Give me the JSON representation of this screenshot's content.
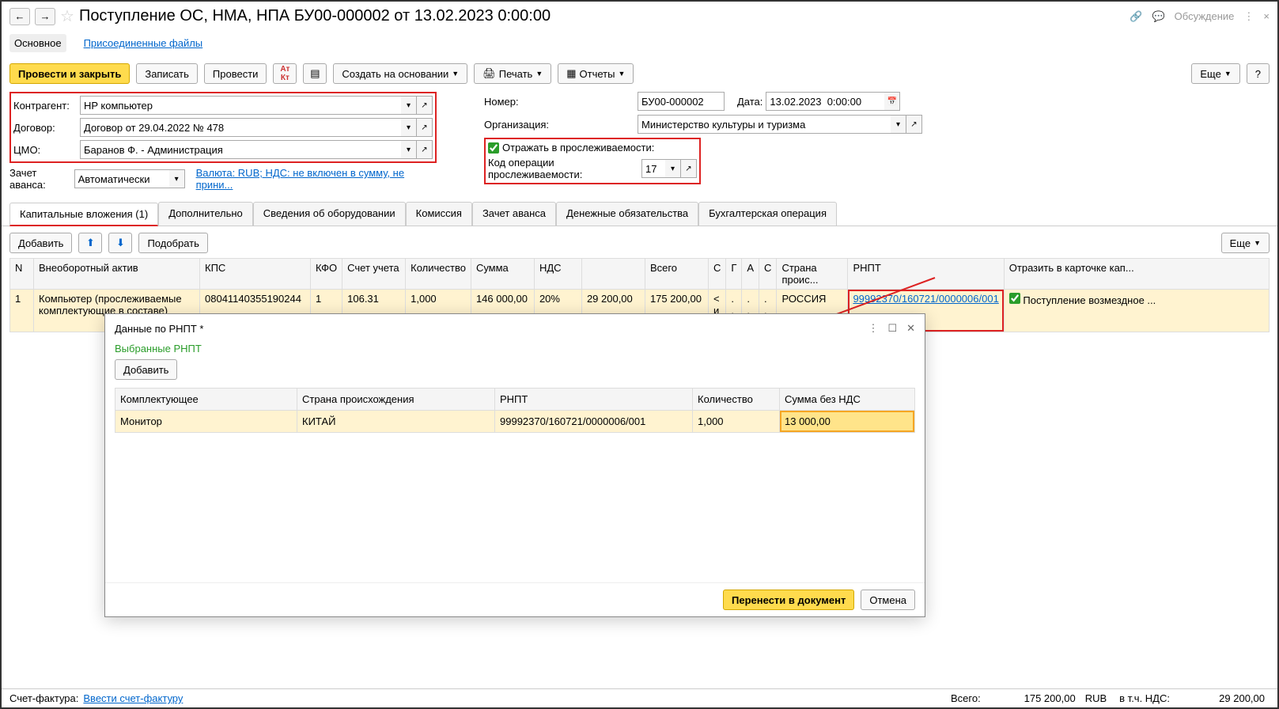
{
  "title": "Поступление ОС, НМА, НПА БУ00-000002 от 13.02.2023 0:00:00",
  "discussion": "Обсуждение",
  "subnav": {
    "main": "Основное",
    "files": "Присоединенные файлы"
  },
  "toolbar": {
    "post_close": "Провести и закрыть",
    "save": "Записать",
    "post": "Провести",
    "create_based": "Создать на основании",
    "print": "Печать",
    "reports": "Отчеты",
    "more": "Еще",
    "help": "?"
  },
  "form": {
    "contragent_lbl": "Контрагент:",
    "contragent": "HP компьютер",
    "contract_lbl": "Договор:",
    "contract": "Договор от 29.04.2022 № 478",
    "cmo_lbl": "ЦМО:",
    "cmo": "Баранов Ф. - Администрация",
    "advance_lbl": "Зачет аванса:",
    "advance": "Автоматически",
    "currency_link": "Валюта: RUB; НДС: не включен в сумму, не прини...",
    "number_lbl": "Номер:",
    "number": "БУ00-000002",
    "date_lbl": "Дата:",
    "date": "13.02.2023  0:00:00",
    "org_lbl": "Организация:",
    "org": "Министерство культуры и туризма",
    "trace_lbl": "Отражать в прослеживаемости:",
    "opcode_lbl": "Код операции прослеживаемости:",
    "opcode": "17"
  },
  "tabs": {
    "t1": "Капитальные вложения (1)",
    "t2": "Дополнительно",
    "t3": "Сведения об оборудовании",
    "t4": "Комиссия",
    "t5": "Зачет аванса",
    "t6": "Денежные обязательства",
    "t7": "Бухгалтерская операция"
  },
  "subbar": {
    "add": "Добавить",
    "pick": "Подобрать",
    "more": "Еще"
  },
  "cols": {
    "n": "N",
    "asset": "Внеоборотный актив",
    "kps": "КПС",
    "kfo": "КФО",
    "acct": "Счет учета",
    "qty": "Количество",
    "sum": "Сумма",
    "vat": "НДС",
    "total": "Всего",
    "c": "С",
    "g": "Г",
    "a": "А",
    "s2": "С",
    "country": "Страна проис...",
    "rnpt": "РНПТ",
    "card": "Отразить в карточке кап..."
  },
  "row": {
    "n": "1",
    "asset": "Компьютер (прослеживаемые комплектующие в составе)",
    "kps": "08041140355190244",
    "kfo": "1",
    "acct": "106.31",
    "qty": "1,000",
    "sum": "146 000,00",
    "vat": "20%",
    "vatsum": "29 200,00",
    "total": "175 200,00",
    "c": "< и",
    "dots": " . . .",
    "country": "РОССИЯ",
    "rnpt": "99992370/160721/0000006/001",
    "card": "Поступление возмездное ..."
  },
  "dialog": {
    "title": "Данные по РНПТ *",
    "subtitle": "Выбранные РНПТ",
    "add": "Добавить",
    "cols": {
      "comp": "Комплектующее",
      "country": "Страна происхождения",
      "rnpt": "РНПТ",
      "qty": "Количество",
      "sum": "Сумма без НДС"
    },
    "row": {
      "comp": "Монитор",
      "country": "КИТАЙ",
      "rnpt": "99992370/160721/0000006/001",
      "qty": "1,000",
      "sum": "13 000,00"
    },
    "ok": "Перенести в документ",
    "cancel": "Отмена"
  },
  "footer": {
    "sf_lbl": "Счет-фактура:",
    "sf_link": "Ввести счет-фактуру",
    "total_lbl": "Всего:",
    "total": "175 200,00",
    "cur": "RUB",
    "vat_lbl": "в т.ч. НДС:",
    "vat": "29 200,00"
  }
}
